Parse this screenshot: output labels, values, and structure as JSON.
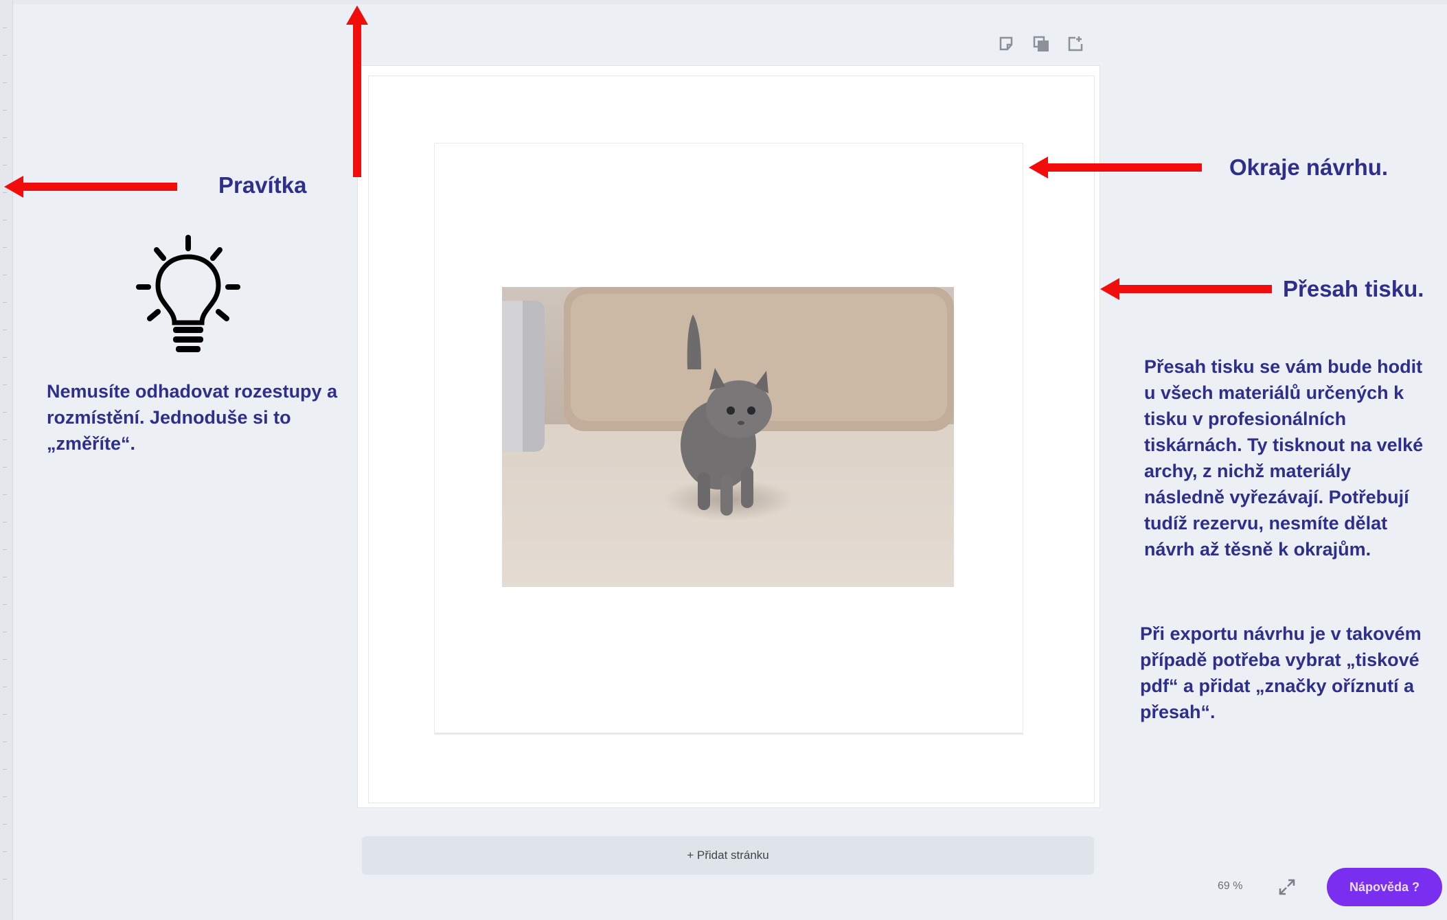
{
  "toolbar": {
    "icons": [
      "note-icon",
      "duplicate-icon",
      "add-page-icon"
    ]
  },
  "canvas": {
    "image_subject": "kitten"
  },
  "add_page_label": "+ Přidat stránku",
  "zoom": {
    "value": "69 %"
  },
  "help_label": "Nápověda ?",
  "annotations": {
    "rulers_label": "Pravítka",
    "design_margins_label": "Okraje návrhu.",
    "bleed_label": "Přesah tisku.",
    "tip_text": "Nemusíte odhadovat rozestupy a rozmístění. Jednoduše si to „změříte“.",
    "bleed_explanation": "Přesah tisku se vám bude hodit u všech materiálů určených k tisku v profesionálních tiskárnách. Ty tisknout na velké archy, z nichž materiály následně vyřezávají. Potřebují tudíž rezervu, nesmíte dělat návrh až těsně k okrajům.",
    "export_note": "Při exportu návrhu je v takovém případě potřeba vybrat „tiskové pdf“ a přidat „značky oříznutí a přesah“."
  },
  "colors": {
    "annotation_text": "#2e2f8a",
    "arrow": "#f20d0d",
    "help_button": "#7a2ef0",
    "canvas_background": "#eceff3"
  }
}
